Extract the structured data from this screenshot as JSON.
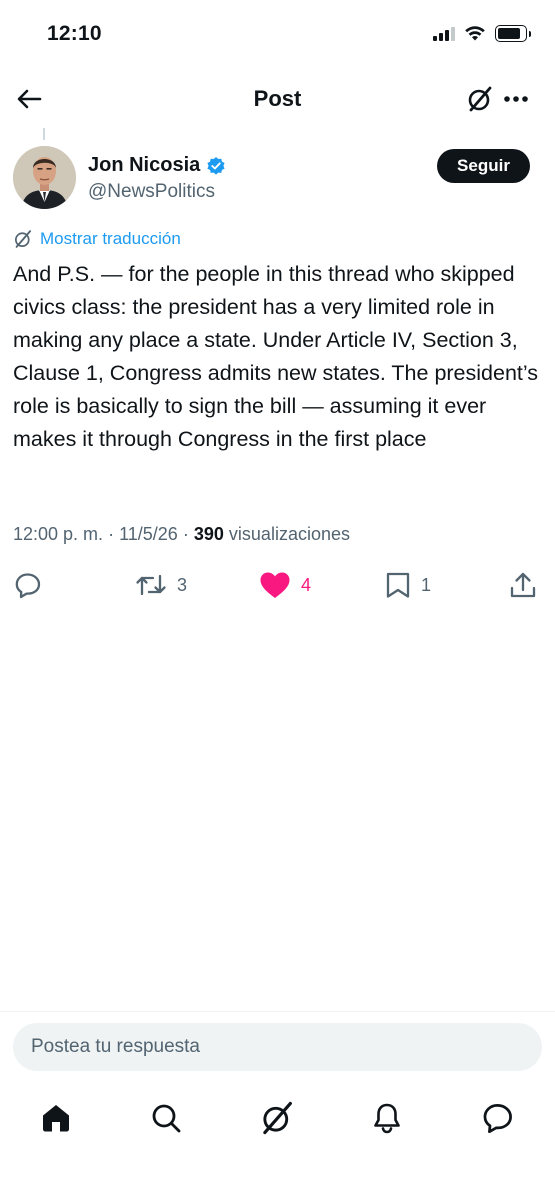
{
  "status_bar": {
    "time": "12:10"
  },
  "header": {
    "title": "Post"
  },
  "author": {
    "name": "Jon Nicosia",
    "handle": "@NewsPolitics",
    "verified": true,
    "follow_label": "Seguir"
  },
  "translate": {
    "label": "Mostrar traducción"
  },
  "post": {
    "text": "And P.S. — for the people in this thread who skipped civics class: the president has a very limited role in making any place a state. Under Article IV, Section 3, Clause 1, Congress admits new states. The president’s role is basically to sign the bill — assuming it ever makes it through Congress in the first place"
  },
  "meta": {
    "time": "12:00 p. m.",
    "separator": "·",
    "date": "11/5/26",
    "views_count": "390",
    "views_label": "visualizaciones"
  },
  "actions": {
    "reply_icon": "reply-icon",
    "retweet_count": "3",
    "like_count": "4",
    "bookmark_count": "1",
    "share_icon": "share-icon",
    "like_color": "#f91880"
  },
  "reply_bar": {
    "placeholder": "Postea tu respuesta"
  },
  "bottom_nav": {
    "items": [
      "home-icon",
      "search-icon",
      "grok-icon",
      "notifications-icon",
      "messages-icon"
    ]
  },
  "colors": {
    "accent": "#1d9bf0",
    "text": "#0f1419",
    "secondary": "#536471",
    "like": "#f91880"
  }
}
